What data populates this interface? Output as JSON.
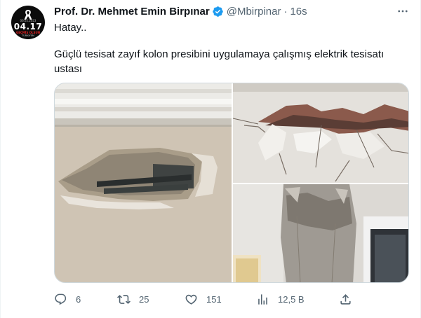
{
  "tweet": {
    "display_name": "Prof. Dr. Mehmet Emin Birpınar",
    "handle": "@Mbirpinar",
    "separator": "·",
    "time": "16s",
    "lines": [
      "Hatay..",
      "Güçlü tesisat zayıf kolon presibini uygulamaya çalışmış elektrik tesisatı ustası"
    ],
    "avatar": {
      "date_small": "06.02.2023",
      "date_big": "04.17",
      "caption_red": "GEÇMİŞ OLSUN",
      "caption_bottom": "TÜRKİYEM"
    },
    "icons": {
      "verified": "verified-badge-icon",
      "more": "more-icon",
      "reply": "reply-icon",
      "retweet": "retweet-icon",
      "like": "like-icon",
      "views": "views-icon",
      "share": "share-icon"
    },
    "colors": {
      "verified": "#1d9bf0",
      "text": "#0f1419",
      "muted": "#536471"
    }
  },
  "stats": {
    "replies": "6",
    "retweets": "25",
    "likes": "151",
    "views": "12,5 B"
  }
}
